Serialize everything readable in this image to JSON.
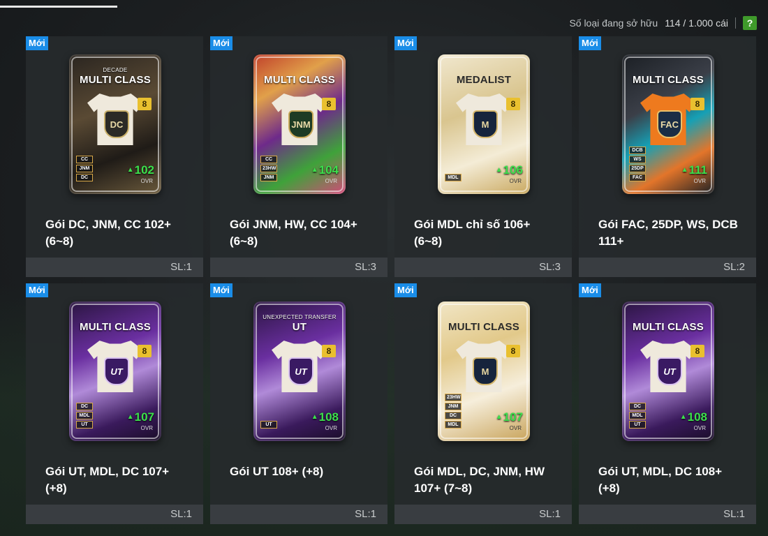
{
  "header": {
    "owned_label": "Số loại đang sở hữu",
    "owned_count": "114 / 1.000 cái",
    "help_label": "?"
  },
  "packs": [
    {
      "badge": "Mới",
      "card_style": "gold",
      "card_subtitle": "DECADE",
      "card_kind": "MULTI CLASS",
      "emblem": "DC",
      "emblem_style": "dc",
      "level": "8",
      "tags": [
        "CC",
        "JNM",
        "DC"
      ],
      "ovr": "102",
      "ovr_label": "OVR",
      "title_line1": "Gói DC, JNM, CC 102+",
      "title_line2": "(6~8)",
      "qty": "SL:1"
    },
    {
      "badge": "Mới",
      "card_style": "tropic",
      "card_subtitle": "",
      "card_kind": "MULTI CLASS",
      "emblem": "JNM",
      "emblem_style": "jnm",
      "level": "8",
      "tags": [
        "CC",
        "23HW",
        "JNM"
      ],
      "ovr": "104",
      "ovr_label": "OVR",
      "title_line1": "Gói JNM, HW, CC 104+",
      "title_line2": "(6~8)",
      "qty": "SL:3"
    },
    {
      "badge": "Mới",
      "card_style": "medal",
      "card_subtitle": "",
      "card_kind": "MEDALIST",
      "emblem": "M",
      "emblem_style": "mdl",
      "level": "8",
      "tags": [
        "MDL"
      ],
      "ovr": "106",
      "ovr_label": "OVR",
      "title_line1": "Gói MDL chỉ số 106+",
      "title_line2": "(6~8)",
      "qty": "SL:3"
    },
    {
      "badge": "Mới",
      "card_style": "dark",
      "card_subtitle": "",
      "card_kind": "MULTI CLASS",
      "emblem": "FAC",
      "emblem_style": "fac",
      "level": "8",
      "tags": [
        "DCB",
        "WS",
        "25DP",
        "FAC"
      ],
      "ovr": "111",
      "ovr_label": "OVR",
      "title_line1": "Gói FAC, 25DP, WS, DCB",
      "title_line2": "111+",
      "qty": "SL:2"
    },
    {
      "badge": "Mới",
      "card_style": "purple",
      "card_subtitle": "",
      "card_kind": "MULTI CLASS",
      "emblem": "UT",
      "emblem_style": "ut",
      "level": "8",
      "tags": [
        "DC",
        "MDL",
        "UT"
      ],
      "ovr": "107",
      "ovr_label": "OVR",
      "title_line1": "Gói UT, MDL, DC 107+",
      "title_line2": "(+8)",
      "qty": "SL:1"
    },
    {
      "badge": "Mới",
      "card_style": "purple",
      "card_subtitle": "UNEXPECTED TRANSFER",
      "card_kind": "UT",
      "emblem": "UT",
      "emblem_style": "ut",
      "level": "8",
      "tags": [
        "UT"
      ],
      "ovr": "108",
      "ovr_label": "OVR",
      "title_line1": "Gói UT 108+ (+8)",
      "title_line2": "",
      "qty": "SL:1"
    },
    {
      "badge": "Mới",
      "card_style": "medal2",
      "card_subtitle": "",
      "card_kind": "MULTI CLASS",
      "emblem": "M",
      "emblem_style": "mdl",
      "level": "8",
      "tags": [
        "23HW",
        "JNM",
        "DC",
        "MDL"
      ],
      "ovr": "107",
      "ovr_label": "OVR",
      "title_line1": "Gói MDL, DC, JNM, HW",
      "title_line2": "107+ (7~8)",
      "qty": "SL:1"
    },
    {
      "badge": "Mới",
      "card_style": "purple",
      "card_subtitle": "",
      "card_kind": "MULTI CLASS",
      "emblem": "UT",
      "emblem_style": "ut",
      "level": "8",
      "tags": [
        "DC",
        "MDL",
        "UT"
      ],
      "ovr": "108",
      "ovr_label": "OVR",
      "title_line1": "Gói UT, MDL, DC 108+",
      "title_line2": "(+8)",
      "qty": "SL:1"
    }
  ],
  "colors": {
    "new_badge": "#1a8de8",
    "ovr_green": "#3ce04c",
    "help_green": "#3f9a2b",
    "level_yellow": "#e9c02f"
  }
}
